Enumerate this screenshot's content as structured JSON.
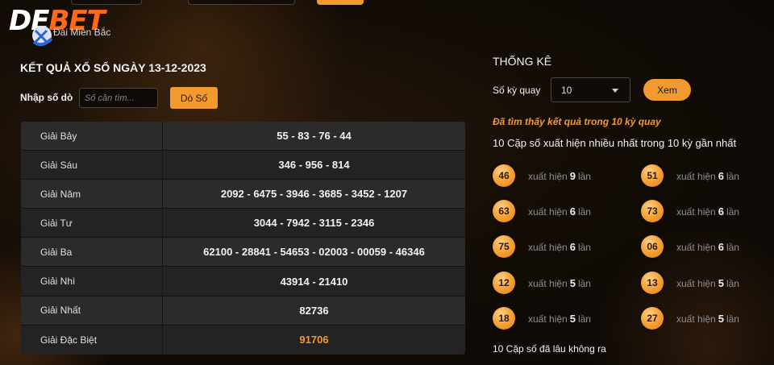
{
  "brand": {
    "logo_part1": "DE",
    "logo_part2": "BET"
  },
  "region": "Đài Miền Bắc",
  "result": {
    "title": "KẾT QUẢ XỔ SỐ NGÀY 13-12-2023",
    "search_label": "Nhập số dò",
    "search_placeholder": "Số cần tìm...",
    "search_button": "Dò Số",
    "rows": [
      {
        "name": "Giải Bảy",
        "value": "55 - 83 - 76 - 44"
      },
      {
        "name": "Giải Sáu",
        "value": "346 - 956 - 814"
      },
      {
        "name": "Giải Năm",
        "value": "2092 - 6475 - 3946 - 3685 - 3452 - 1207"
      },
      {
        "name": "Giải Tư",
        "value": "3044 - 7942 - 3115 - 2346"
      },
      {
        "name": "Giải Ba",
        "value": "62100 - 28841 - 54653 - 02003 - 00059 - 46346"
      },
      {
        "name": "Giải Nhì",
        "value": "43914 - 21410"
      },
      {
        "name": "Giải Nhất",
        "value": "82736"
      },
      {
        "name": "Giải Đặc Biệt",
        "value": "91706"
      }
    ]
  },
  "stats": {
    "title": "THỐNG KÊ",
    "periods_label": "Số kỳ quay",
    "periods_value": "10",
    "view_button": "Xem",
    "found_text": "Đã tìm thấy kết quả trong 10 kỳ quay",
    "top_title": "10 Cặp số xuất hiện nhiều nhất trong 10 kỳ gần nhất",
    "appear_prefix": "xuất hiện",
    "appear_suffix": "lần",
    "pairs": [
      {
        "number": "46",
        "count": "9"
      },
      {
        "number": "51",
        "count": "6"
      },
      {
        "number": "63",
        "count": "6"
      },
      {
        "number": "73",
        "count": "6"
      },
      {
        "number": "75",
        "count": "6"
      },
      {
        "number": "06",
        "count": "6"
      },
      {
        "number": "12",
        "count": "5"
      },
      {
        "number": "13",
        "count": "5"
      },
      {
        "number": "18",
        "count": "5"
      },
      {
        "number": "27",
        "count": "5"
      }
    ],
    "absent_title": "10 Cặp số đã lâu không ra"
  },
  "colors": {
    "accent": "#f39a2e",
    "special_prize": "#f39a2e",
    "logo_accent": "#ff6a1a"
  }
}
